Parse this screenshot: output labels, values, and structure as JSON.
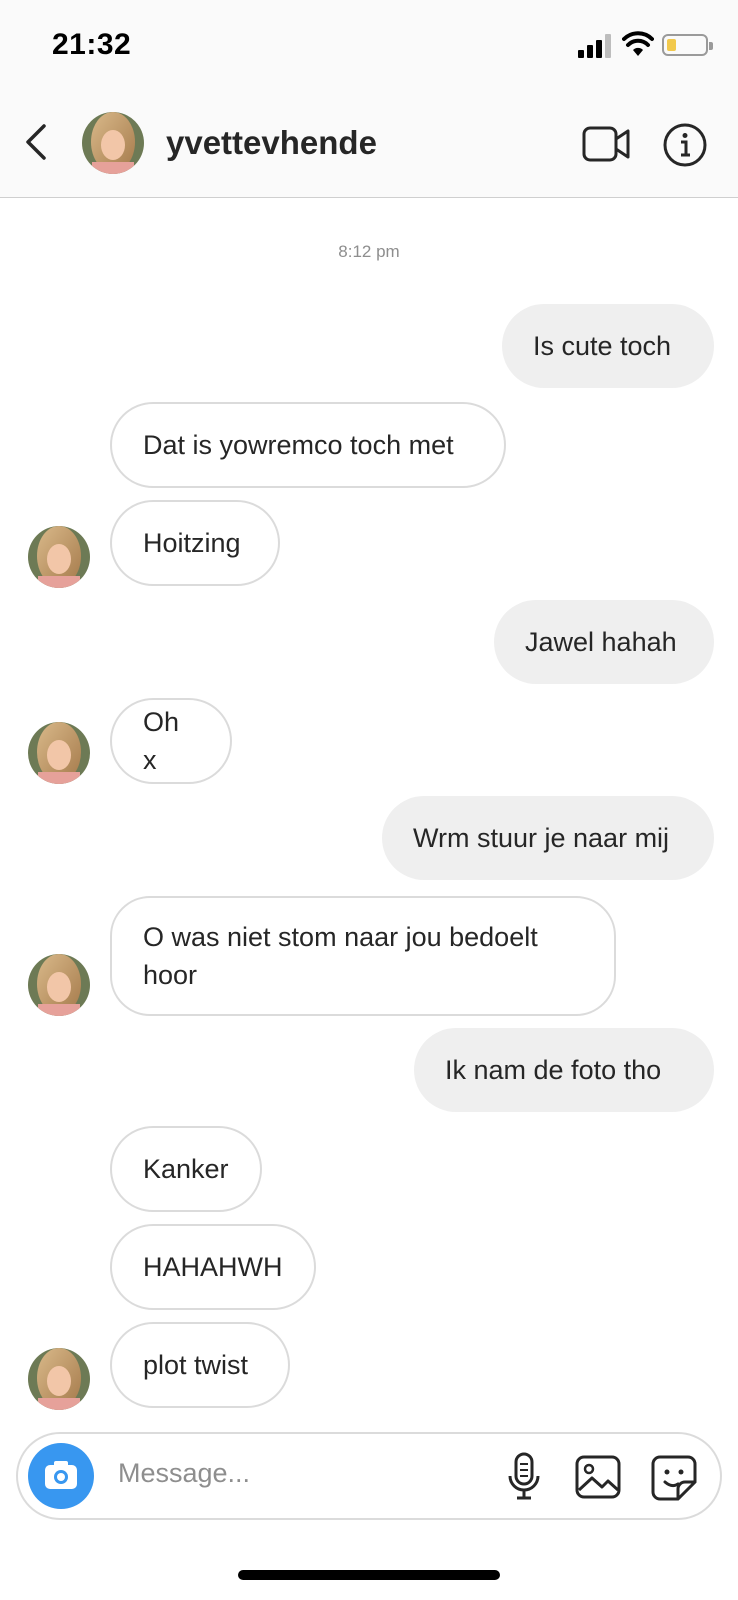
{
  "status_bar": {
    "time": "21:32"
  },
  "header": {
    "username": "yvettevhende",
    "back_icon": "chevron-left-icon",
    "video_icon": "video-camera-icon",
    "info_icon": "info-icon"
  },
  "conversation": {
    "timestamp": "8:12 pm",
    "messages": [
      {
        "sender": "me",
        "text": "Is cute toch"
      },
      {
        "sender": "them",
        "text": "Dat is yowremco toch met"
      },
      {
        "sender": "them",
        "text": "Hoitzing"
      },
      {
        "sender": "me",
        "text": "Jawel hahah"
      },
      {
        "sender": "them",
        "text": "Oh x"
      },
      {
        "sender": "me",
        "text": "Wrm stuur je naar mij"
      },
      {
        "sender": "them",
        "text": "O was niet stom naar jou bedoelt hoor"
      },
      {
        "sender": "me",
        "text": "Ik nam de foto tho"
      },
      {
        "sender": "them",
        "text": "Kanker"
      },
      {
        "sender": "them",
        "text": "HAHAHWH"
      },
      {
        "sender": "them",
        "text": "plot twist"
      }
    ]
  },
  "composer": {
    "placeholder": "Message...",
    "camera_icon": "camera-icon",
    "mic_icon": "microphone-icon",
    "gallery_icon": "gallery-icon",
    "sticker_icon": "sticker-icon"
  },
  "colors": {
    "accent": "#3897f0",
    "outgoing_bubble": "#efefef",
    "incoming_border": "#dbdbdb",
    "text": "#262626",
    "muted": "#8e8e8e"
  }
}
